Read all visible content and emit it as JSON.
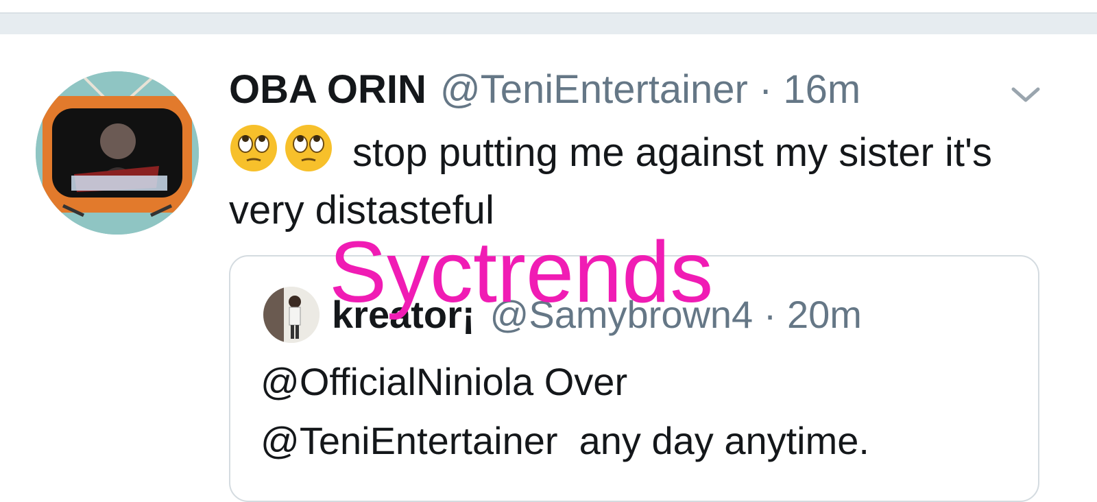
{
  "tweet": {
    "display_name": "OBA ORIN",
    "handle_time": "@TeniEntertainer · 16m",
    "emojis": [
      "face-with-rolling-eyes-emoji",
      "face-with-rolling-eyes-emoji"
    ],
    "text": "stop putting me against my sister it's very distasteful",
    "avatar_icon": "avatar-retro-tv-power-rangers"
  },
  "quoted_tweet": {
    "display_name": "kreator¡",
    "handle_time": "@Samybrown4 · 20m",
    "text": "@OfficialNiniola Over\n@TeniEntertainer  any day anytime.",
    "avatar_icon": "avatar-person-photo"
  },
  "watermark": "Syctrends",
  "colors": {
    "text": "#14171a",
    "secondary_text": "#657786",
    "divider_bg": "#e6ecf0",
    "watermark": "#f01cb4"
  }
}
